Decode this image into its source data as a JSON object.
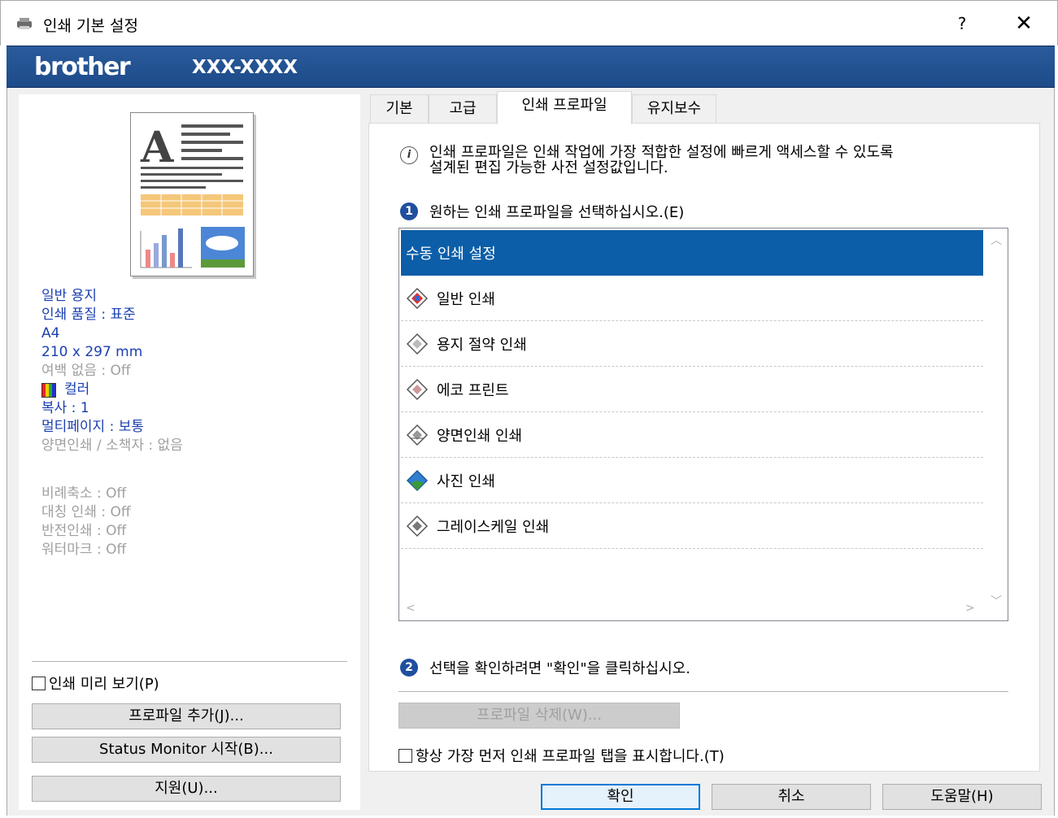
{
  "window": {
    "title": "인쇄 기본 설정",
    "help_label": "?",
    "close_label": "✕"
  },
  "banner": {
    "logo": "brother",
    "model": "XXX-XXXX"
  },
  "left": {
    "info": {
      "paper_type": "일반 용지",
      "quality": "인쇄 품질 : 표준",
      "paper_size": "A4",
      "dimensions": "210 x 297 mm",
      "borderless": "여백 없음 : Off",
      "color_mode": "컬러",
      "copies": "복사 : 1",
      "multipage": "멀티페이지 : 보통",
      "duplex": "양면인쇄 / 소책자 : 없음",
      "scaling": "비례축소 : Off",
      "mirror": "대칭 인쇄 : Off",
      "reverse": "반전인쇄 : Off",
      "watermark": "워터마크 : Off"
    },
    "preview_label": "인쇄 미리 보기(P)",
    "add_profile_label": "프로파일 추가(J)...",
    "status_monitor_label": "Status Monitor 시작(B)...",
    "support_label": "지원(U)..."
  },
  "tabs": [
    {
      "label": "기본"
    },
    {
      "label": "고급"
    },
    {
      "label": "인쇄 프로파일"
    },
    {
      "label": "유지보수"
    }
  ],
  "profile": {
    "info_line1": "인쇄 프로파일은 인쇄 작업에 가장 적합한 설정에 빠르게 액세스할 수 있도록",
    "info_line2": "설계된 편집 가능한 사전 설정값입니다.",
    "step1_num": "1",
    "step1_label": "원하는 인쇄 프로파일을 선택하십시오.(E)",
    "step2_num": "2",
    "step2_label": "선택을 확인하려면 \"확인\"을 클릭하십시오.",
    "items": [
      {
        "label": "수동 인쇄 설정",
        "icon": "none"
      },
      {
        "label": "일반 인쇄",
        "icon": "general-print-icon"
      },
      {
        "label": "용지 절약 인쇄",
        "icon": "paper-save-icon"
      },
      {
        "label": "에코 프린트",
        "icon": "eco-print-icon"
      },
      {
        "label": "양면인쇄 인쇄",
        "icon": "duplex-print-icon"
      },
      {
        "label": "사진 인쇄",
        "icon": "photo-print-icon"
      },
      {
        "label": "그레이스케일 인쇄",
        "icon": "grayscale-print-icon"
      }
    ],
    "delete_label": "프로파일 삭제(W)...",
    "always_show_label": "항상 가장 먼저 인쇄 프로파일 탭을 표시합니다.(T)"
  },
  "footer": {
    "ok_label": "확인",
    "cancel_label": "취소",
    "help_label": "도움말(H)"
  },
  "colors": {
    "banner": "#1d4b8a",
    "selection": "#0c5ea8",
    "info_blue": "#1a3fb0"
  }
}
